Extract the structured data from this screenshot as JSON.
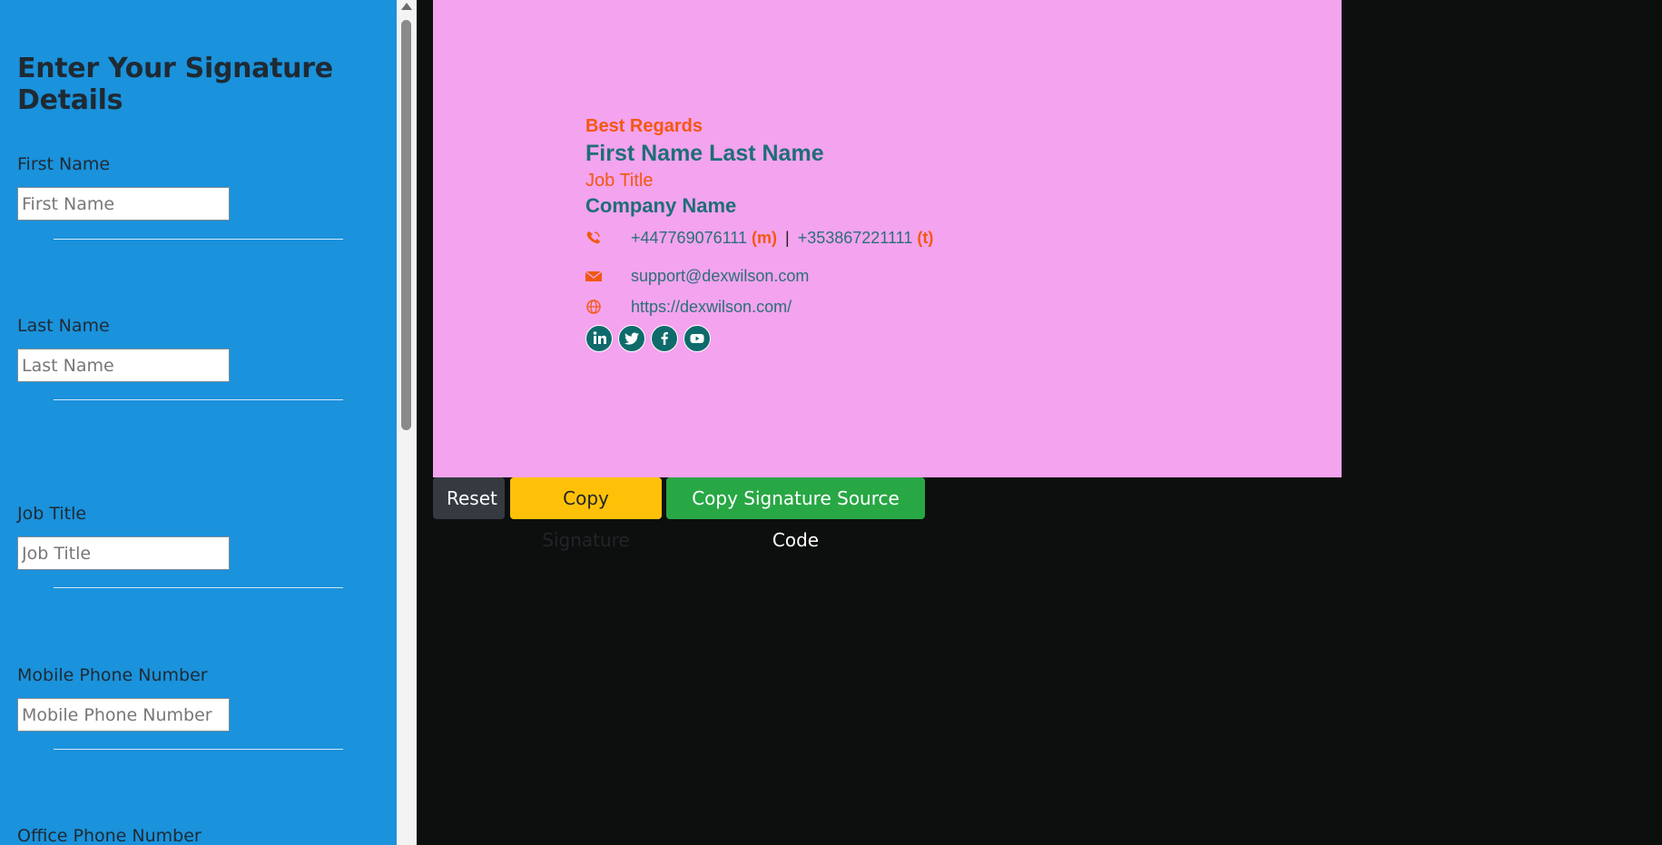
{
  "form": {
    "title": "Enter Your Signature Details",
    "fields": [
      {
        "label": "First Name",
        "placeholder": "First Name",
        "value": ""
      },
      {
        "label": "Last Name",
        "placeholder": "Last Name",
        "value": ""
      },
      {
        "label": "Job Title",
        "placeholder": "Job Title",
        "value": ""
      },
      {
        "label": "Mobile Phone Number",
        "placeholder": "Mobile Phone Number",
        "value": ""
      },
      {
        "label": "Office Phone Number"
      }
    ]
  },
  "signature": {
    "background": "#f4a3ee",
    "accent_color": "#f2590f",
    "primary_color": "#1e6e77",
    "greeting": "Best Regards",
    "name": "First Name Last Name",
    "job_title": "Job Title",
    "company": "Company Name",
    "mobile": "+447769076111",
    "mobile_tag": "(m)",
    "separator": "|",
    "office": "+353867221111",
    "office_tag": "(t)",
    "email": "support@dexwilson.com",
    "website": "https://dexwilson.com/",
    "social_icons": [
      "linkedin-icon",
      "twitter-icon",
      "facebook-icon",
      "youtube-icon"
    ]
  },
  "buttons": {
    "reset": "Reset",
    "copy": "Copy Signature",
    "copy_source": "Copy Signature Source Code"
  }
}
